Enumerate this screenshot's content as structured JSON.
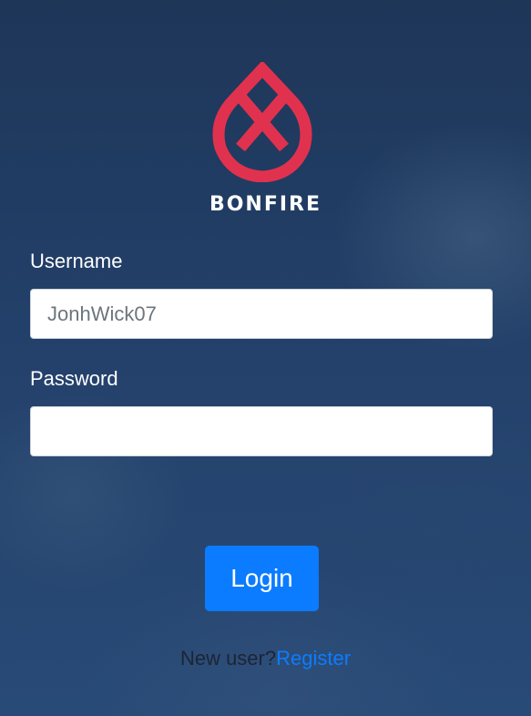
{
  "app": {
    "brand_name": "BONFIRE",
    "logo_icon": "bonfire-logo-icon",
    "logo_color": "#e0324e"
  },
  "form": {
    "username_label": "Username",
    "username_value": "JonhWick07",
    "password_label": "Password",
    "password_value": "",
    "login_label": "Login"
  },
  "footer": {
    "new_user_text": "New user?",
    "register_label": "Register"
  },
  "colors": {
    "accent": "#0b7cff",
    "background": "#213a5b"
  }
}
